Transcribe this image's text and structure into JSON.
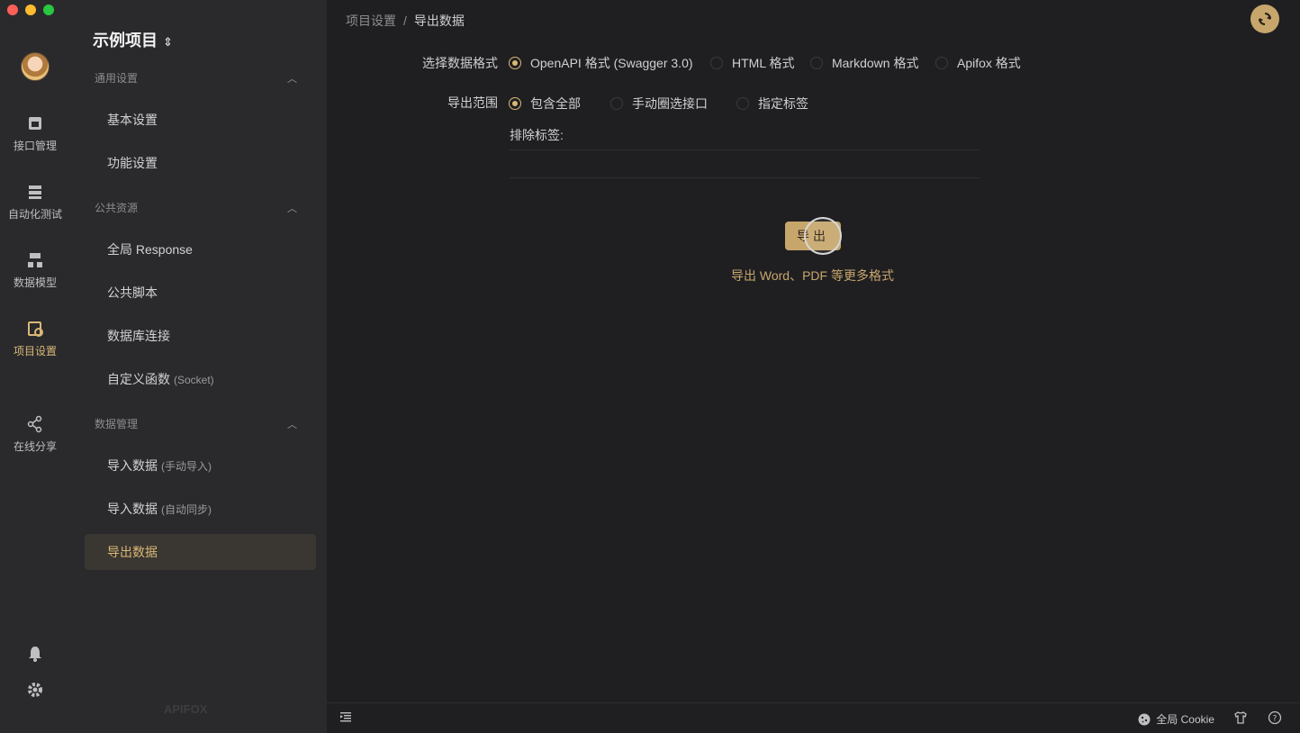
{
  "sidebar": {
    "project_name": "示例项目",
    "project_caret": "⌃",
    "groups": [
      {
        "title": "通用设置"
      },
      {
        "title": "公共资源"
      },
      {
        "title": "数据管理"
      }
    ],
    "items": [
      {
        "label": "基本设置",
        "sub": ""
      },
      {
        "label": "功能设置",
        "sub": ""
      },
      {
        "label": "全局 Response",
        "sub": ""
      },
      {
        "label": "公共脚本",
        "sub": ""
      },
      {
        "label": "数据库连接",
        "sub": ""
      },
      {
        "label": "自定义函数",
        "sub": "(Socket)"
      },
      {
        "label": "导入数据",
        "sub": "(手动导入)"
      },
      {
        "label": "导入数据",
        "sub": "(自动同步)"
      },
      {
        "label": "导出数据",
        "sub": ""
      }
    ],
    "watermark": "APIFOX"
  },
  "rail": {
    "items": [
      {
        "label": "接口管理",
        "icon": "api-icon"
      },
      {
        "label": "自动化测试",
        "icon": "test-icon"
      },
      {
        "label": "数据模型",
        "icon": "model-icon"
      },
      {
        "label": "项目设置",
        "icon": "settings-doc-icon"
      },
      {
        "label": "在线分享",
        "icon": "share-icon"
      }
    ]
  },
  "breadcrumb": {
    "parent": "项目设置",
    "separator": "/",
    "current": "导出数据"
  },
  "form": {
    "format_label": "选择数据格式",
    "formats": [
      {
        "label": "OpenAPI 格式 (Swagger 3.0)",
        "checked": true
      },
      {
        "label": "HTML 格式",
        "checked": false
      },
      {
        "label": "Markdown 格式",
        "checked": false
      },
      {
        "label": "Apifox 格式",
        "checked": false
      }
    ],
    "scope_label": "导出范围",
    "scopes": [
      {
        "label": "包含全部",
        "checked": true
      },
      {
        "label": "手动圈选接口",
        "checked": false
      },
      {
        "label": "指定标签",
        "checked": false
      }
    ],
    "exclude_label": "排除标签:",
    "export_button": "导出",
    "more_formats": "导出 Word、PDF 等更多格式"
  },
  "statusbar": {
    "cookie_label": "全局 Cookie"
  },
  "colors": {
    "accent": "#d9b877",
    "button": "#c7a66c",
    "background": "#1f1f22",
    "sidebar": "#2a2a2d"
  }
}
